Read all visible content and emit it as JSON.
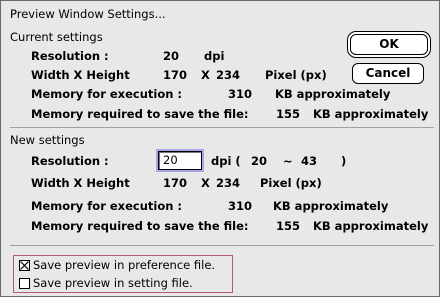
{
  "dialog": {
    "title": "Preview Window Settings..."
  },
  "buttons": {
    "ok_label": "OK",
    "cancel_label": "Cancel"
  },
  "current": {
    "heading": "Current settings",
    "resolution_label": "Resolution :",
    "resolution_value": "20",
    "resolution_unit": "dpi",
    "wh_label": "Width X Height",
    "width": "170",
    "times": "X",
    "height": "234",
    "pixel_unit": "Pixel (px)",
    "mem_exec_label": "Memory for execution :",
    "mem_exec_value": "310",
    "mem_exec_unit": "KB approximately",
    "mem_save_label": "Memory required to save the file:",
    "mem_save_value": "155",
    "mem_save_unit": "KB approximately"
  },
  "new": {
    "heading": "New settings",
    "resolution_label": "Resolution :",
    "resolution_input": "20",
    "range_prefix": "dpi (",
    "range_min": "20",
    "range_tilde": "~",
    "range_max": "43",
    "range_suffix": ")",
    "wh_label": "Width X Height",
    "width": "170",
    "times": "X",
    "height": "234",
    "pixel_unit": "Pixel (px)",
    "mem_exec_label": "Memory for execution :",
    "mem_exec_value": "310",
    "mem_exec_unit": "KB approximately",
    "mem_save_label": "Memory required to save the file:",
    "mem_save_value": "155",
    "mem_save_unit": "KB approximately"
  },
  "options": [
    {
      "label": "Save preview in preference file.",
      "checked": true
    },
    {
      "label": "Save preview in setting file.",
      "checked": false
    }
  ]
}
